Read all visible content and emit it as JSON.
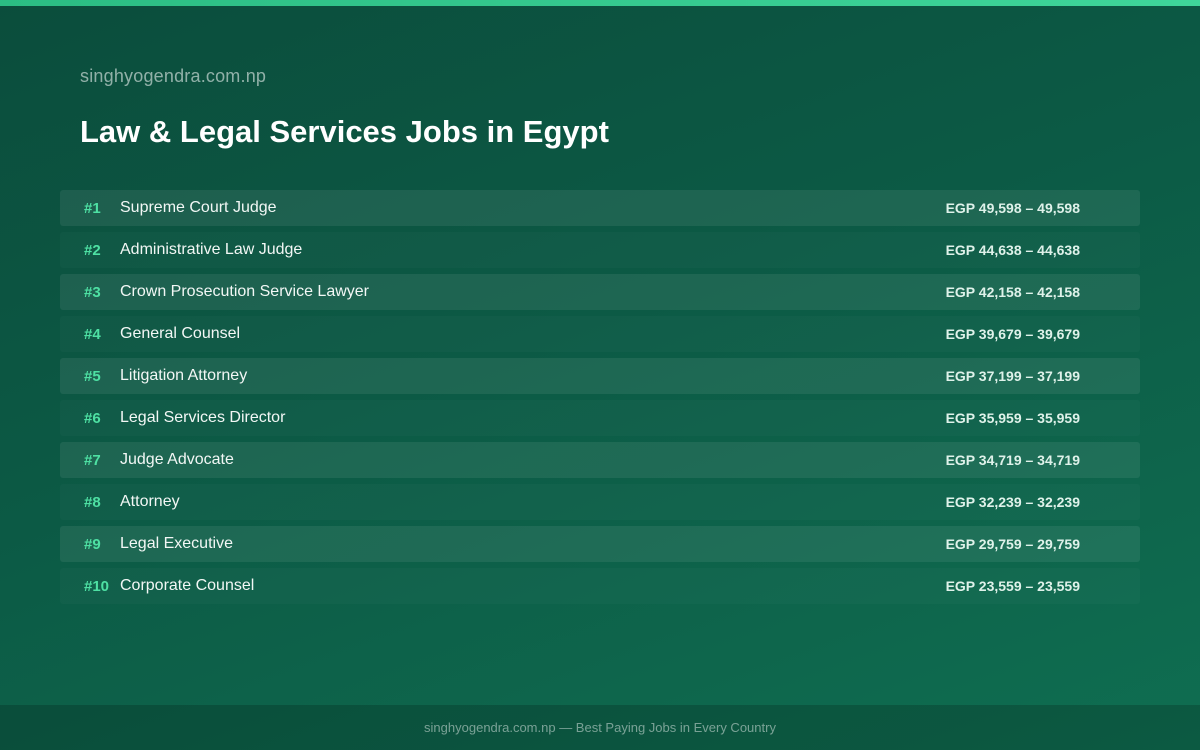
{
  "site_name": "singhyogendra.com.np",
  "title": "Law & Legal Services Jobs in Egypt",
  "jobs": [
    {
      "rank": "#1",
      "title": "Supreme Court Judge",
      "salary": "EGP 49,598 – 49,598"
    },
    {
      "rank": "#2",
      "title": "Administrative Law Judge",
      "salary": "EGP 44,638 – 44,638"
    },
    {
      "rank": "#3",
      "title": "Crown Prosecution Service Lawyer",
      "salary": "EGP 42,158 – 42,158"
    },
    {
      "rank": "#4",
      "title": "General Counsel",
      "salary": "EGP 39,679 – 39,679"
    },
    {
      "rank": "#5",
      "title": "Litigation Attorney",
      "salary": "EGP 37,199 – 37,199"
    },
    {
      "rank": "#6",
      "title": "Legal Services Director",
      "salary": "EGP 35,959 – 35,959"
    },
    {
      "rank": "#7",
      "title": "Judge Advocate",
      "salary": "EGP 34,719 – 34,719"
    },
    {
      "rank": "#8",
      "title": "Attorney",
      "salary": "EGP 32,239 – 32,239"
    },
    {
      "rank": "#9",
      "title": "Legal Executive",
      "salary": "EGP 29,759 – 29,759"
    },
    {
      "rank": "#10",
      "title": "Corporate Counsel",
      "salary": "EGP 23,559 – 23,559"
    }
  ],
  "footer": "singhyogendra.com.np — Best Paying Jobs in Every Country",
  "colors": {
    "accent": "#4ee0a3",
    "background": "#0c5a45",
    "top_bar": "#2bbd83"
  }
}
